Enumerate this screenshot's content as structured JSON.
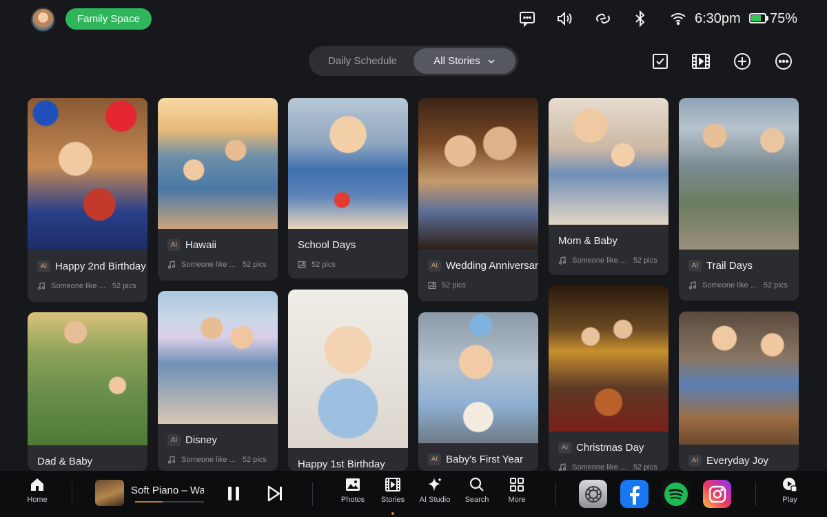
{
  "status_bar": {
    "space_label": "Family Space",
    "time": "6:30pm",
    "battery_percent": "75%",
    "battery_level": 0.75,
    "icons": [
      "message-icon",
      "volume-icon",
      "link-icon",
      "bluetooth-icon",
      "wifi-icon"
    ]
  },
  "tabs": {
    "daily": "Daily Schedule",
    "all": "All Stories"
  },
  "toolbar": [
    "select-icon",
    "film-icon",
    "add-icon",
    "more-icon"
  ],
  "cards": [
    {
      "title": "Happy 2nd Birthday",
      "ai": true,
      "music": "Someone like ...",
      "count": "52 pics",
      "theme": "birthday2"
    },
    {
      "title": "Hawaii",
      "ai": true,
      "music": "Someone like ...",
      "count": "52 pics",
      "theme": "hawaii"
    },
    {
      "title": "School Days",
      "ai": false,
      "music": "",
      "count": "52 pics",
      "theme": "school"
    },
    {
      "title": "Wedding Anniversary",
      "ai": true,
      "music": "",
      "count": "52 pics",
      "theme": "wedding"
    },
    {
      "title": "Mom & Baby",
      "ai": false,
      "music": "Someone like ...",
      "count": "52 pics",
      "theme": "mom"
    },
    {
      "title": "Trail Days",
      "ai": true,
      "music": "Someone like ...",
      "count": "52 pics",
      "theme": "trail"
    },
    {
      "title": "Dad & Baby",
      "ai": false,
      "music": "",
      "count": "",
      "theme": "dad"
    },
    {
      "title": "Disney",
      "ai": true,
      "music": "Someone like ...",
      "count": "52 pics",
      "theme": "disney"
    },
    {
      "title": "Happy 1st Birthday",
      "ai": false,
      "music": "",
      "count": "",
      "theme": "baby"
    },
    {
      "title": "Baby's First Year",
      "ai": true,
      "music": "",
      "count": "",
      "theme": "firstyear"
    },
    {
      "title": "Christmas Day",
      "ai": true,
      "music": "Someone like ...",
      "count": "52 pics",
      "theme": "christmas"
    },
    {
      "title": "Everyday Joy",
      "ai": true,
      "music": "",
      "count": "",
      "theme": "joy"
    }
  ],
  "dock": {
    "home": "Home",
    "now_playing": "Soft Piano – Warm",
    "progress": 0.4,
    "photos": "Photos",
    "stories": "Stories",
    "ai_studio": "AI Studio",
    "search": "Search",
    "more": "More",
    "play": "Play",
    "apps": [
      "settings-icon",
      "facebook-icon",
      "spotify-icon",
      "instagram-icon"
    ]
  },
  "colors": {
    "accent_green": "#2fb65a",
    "background": "#17181b",
    "card": "#2a2c31",
    "facebook": "#1877f2",
    "spotify": "#1db954"
  }
}
